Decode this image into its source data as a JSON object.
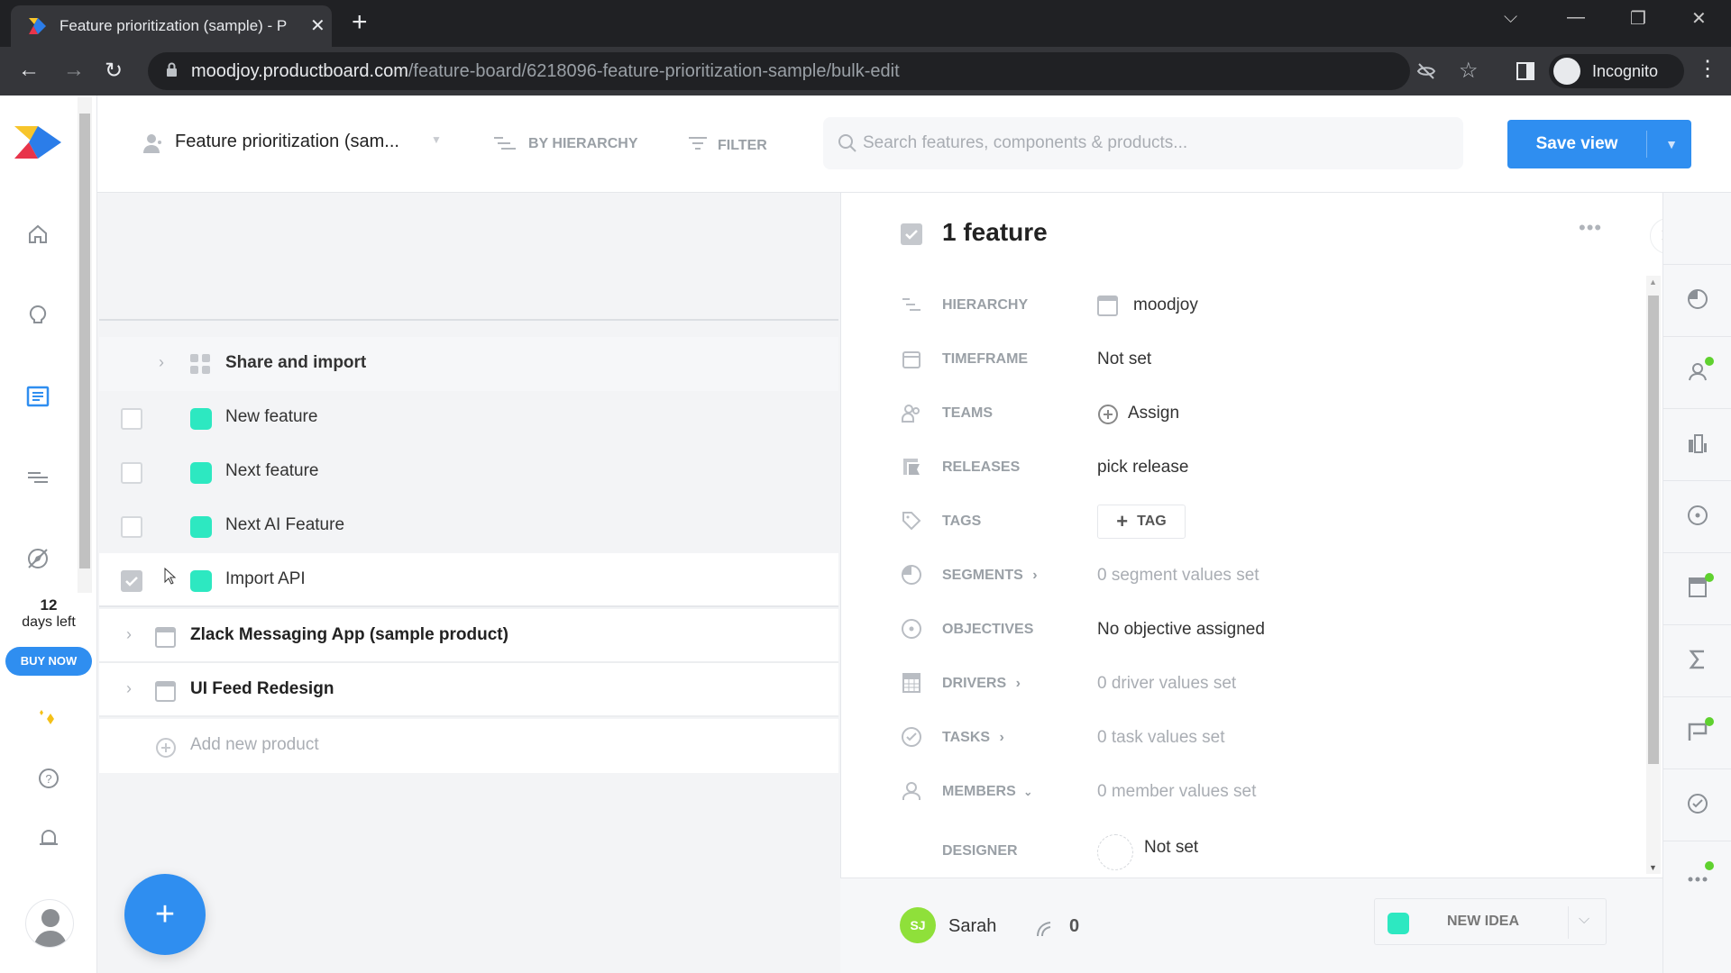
{
  "browser": {
    "tab_title": "Feature prioritization (sample) - P",
    "new_tab_icon": "plus-icon",
    "url_domain": "moodjoy.productboard.com",
    "url_path": "/feature-board/6218096-feature-prioritization-sample/bulk-edit",
    "profile_label": "Incognito"
  },
  "left_nav": {
    "items": [
      {
        "icon": "home-icon"
      },
      {
        "icon": "lightbulb-icon"
      },
      {
        "icon": "board-icon",
        "active": true
      },
      {
        "icon": "roadmap-icon"
      },
      {
        "icon": "compass-icon"
      }
    ],
    "trial_days": "12",
    "trial_label": "days left",
    "buy_now": "BUY NOW",
    "bottom_icons": [
      "sparkle-icon",
      "help-icon",
      "bell-icon",
      "avatar"
    ]
  },
  "topbar": {
    "board_name": "Feature prioritization (sam...",
    "group_by": "BY HIERARCHY",
    "filter": "FILTER",
    "search_placeholder": "Search features, components & products...",
    "save_view": "Save view"
  },
  "board": {
    "component": "Share and import",
    "features": [
      {
        "name": "New feature",
        "checked": false,
        "status_color": "#2de8c1"
      },
      {
        "name": "Next feature",
        "checked": false,
        "status_color": "#2de8c1"
      },
      {
        "name": "Next AI Feature",
        "checked": false,
        "status_color": "#2de8c1"
      },
      {
        "name": "Import API",
        "checked": true,
        "status_color": "#2de8c1"
      }
    ],
    "products": [
      {
        "name": "Zlack Messaging App (sample product)"
      },
      {
        "name": "UI Feed Redesign"
      }
    ],
    "add_product": "Add new product"
  },
  "detail": {
    "title": "1 feature",
    "properties": [
      {
        "label": "HIERARCHY",
        "value": "moodjoy",
        "icon": "hierarchy-icon"
      },
      {
        "label": "TIMEFRAME",
        "value": "Not set",
        "icon": "calendar-icon"
      },
      {
        "label": "TEAMS",
        "value": "Assign",
        "icon": "teams-icon"
      },
      {
        "label": "RELEASES",
        "value": "pick release",
        "icon": "release-flag-icon"
      },
      {
        "label": "TAGS",
        "value": "TAG",
        "icon": "tag-icon"
      },
      {
        "label": "SEGMENTS",
        "value": "0 segment values set",
        "icon": "segments-icon"
      },
      {
        "label": "OBJECTIVES",
        "value": "No objective assigned",
        "icon": "objective-icon"
      },
      {
        "label": "DRIVERS",
        "value": "0 driver values set",
        "icon": "drivers-icon"
      },
      {
        "label": "TASKS",
        "value": "0 task values set",
        "icon": "tasks-icon"
      },
      {
        "label": "MEMBERS",
        "value": "0 member values set",
        "icon": "members-icon"
      },
      {
        "label": "DESIGNER",
        "value": "Not set"
      }
    ],
    "footer": {
      "owner_initials": "SJ",
      "owner_name": "Sarah",
      "votes": "0",
      "status": "NEW IDEA",
      "status_color": "#2de8c1"
    }
  },
  "right_rail": [
    "segments-icon",
    "persona-icon",
    "company-icon",
    "objective-icon",
    "drivers-icon",
    "sum-icon",
    "release-icon",
    "tasks-icon",
    "more-icon"
  ],
  "colors": {
    "accent": "#2f8ef0",
    "status_new_idea": "#2de8c1",
    "indicator": "#5fd12f"
  }
}
